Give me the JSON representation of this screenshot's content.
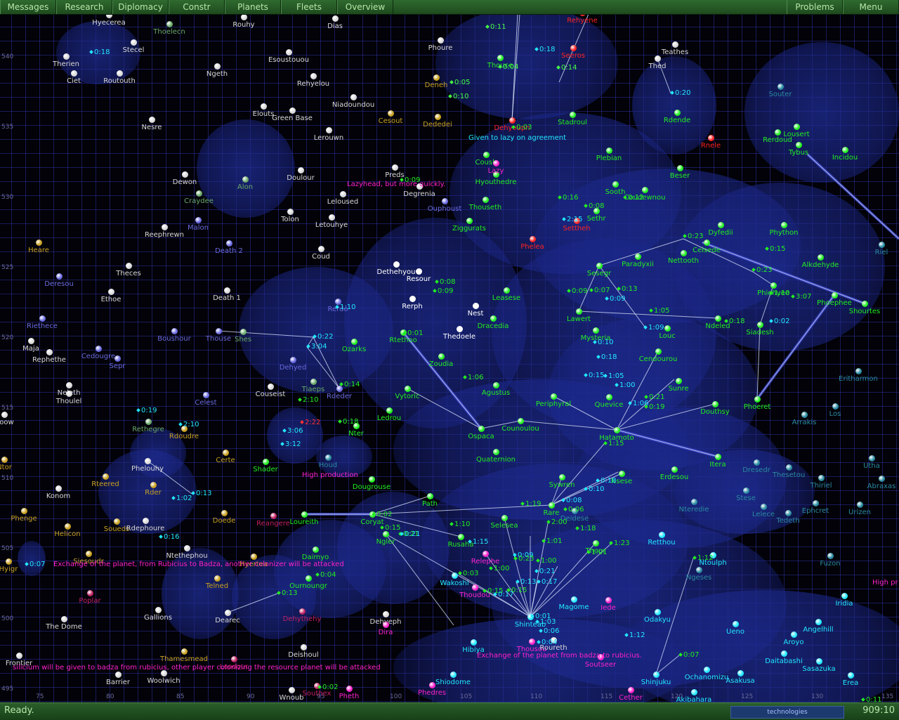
{
  "menu": {
    "items": [
      "Messages",
      "Research",
      "Diplomacy",
      "Constr",
      "Planets",
      "Fleets",
      "Overview"
    ],
    "right_items": [
      "Problems",
      "Menu"
    ]
  },
  "status": {
    "text": "Ready.",
    "clock": "909:10",
    "logo_text": "technologies"
  },
  "colors": {
    "player": "#22ee22",
    "neutral": "#d8d8d8",
    "bright": "#ffffff",
    "gold": "#c8a020",
    "enemy_red": "#ff2222",
    "magenta": "#ff22cc",
    "cyan": "#22e8ff",
    "dim_green": "#6aa86a",
    "violet": "#6a6ae0",
    "teal": "#2a8aa0",
    "maroon": "#c02060"
  },
  "x_axis": [
    "75",
    "80",
    "85",
    "90",
    "95",
    "100",
    "105",
    "110",
    "115",
    "120",
    "125",
    "130",
    "135"
  ],
  "y_axis": [
    "540",
    "535",
    "530",
    "525",
    "520",
    "515",
    "510",
    "505",
    "500",
    "495"
  ],
  "stars": [
    {
      "n": "Hyecerea",
      "c": "neutral"
    },
    {
      "n": "Thoelecn",
      "c": "dim_green"
    },
    {
      "n": "Rouhy",
      "c": "neutral"
    },
    {
      "n": "Dias",
      "c": "neutral"
    },
    {
      "n": "Therien",
      "c": "neutral"
    },
    {
      "n": "Stecel",
      "c": "neutral"
    },
    {
      "n": "Ciet",
      "c": "neutral"
    },
    {
      "n": "Routouth",
      "c": "neutral"
    },
    {
      "n": "Ngeth",
      "c": "neutral"
    },
    {
      "n": "Esoustouou",
      "c": "neutral"
    },
    {
      "n": "Rehyelou",
      "c": "neutral"
    },
    {
      "n": "Niadoundou",
      "c": "neutral"
    },
    {
      "n": "Nesre",
      "c": "neutral"
    },
    {
      "n": "Elouts",
      "c": "neutral"
    },
    {
      "n": "Green Base",
      "c": "neutral"
    },
    {
      "n": "Lerouwn",
      "c": "neutral"
    },
    {
      "n": "Cesout",
      "c": "gold"
    },
    {
      "n": "Phoure",
      "c": "neutral"
    },
    {
      "n": "Deneh",
      "c": "gold"
    },
    {
      "n": "Dededei",
      "c": "gold"
    },
    {
      "n": "Thouce",
      "c": "player"
    },
    {
      "n": "Seeros",
      "c": "enemy_red"
    },
    {
      "n": "Rehyene",
      "c": "enemy_red"
    },
    {
      "n": "Dehyouph",
      "c": "enemy_red"
    },
    {
      "n": "Stadroul",
      "c": "player"
    },
    {
      "n": "Teathes",
      "c": "neutral"
    },
    {
      "n": "Thed",
      "c": "neutral"
    },
    {
      "n": "Rdende",
      "c": "player"
    },
    {
      "n": "Souter",
      "c": "teal"
    },
    {
      "n": "Rnele",
      "c": "enemy_red"
    },
    {
      "n": "Rerdoud",
      "c": "player"
    },
    {
      "n": "Lousert",
      "c": "player"
    },
    {
      "n": "Tybus",
      "c": "player"
    },
    {
      "n": "Incidou",
      "c": "player"
    },
    {
      "n": "Dewon",
      "c": "neutral"
    },
    {
      "n": "Alon",
      "c": "dim_green"
    },
    {
      "n": "Doulour",
      "c": "neutral"
    },
    {
      "n": "Craydee",
      "c": "dim_green"
    },
    {
      "n": "Preds",
      "c": "neutral"
    },
    {
      "n": "Degrenia",
      "c": "neutral"
    },
    {
      "n": "Ouphoust",
      "c": "violet"
    },
    {
      "n": "Leloused",
      "c": "neutral"
    },
    {
      "n": "Coush",
      "c": "player"
    },
    {
      "n": "Hyouthedre",
      "c": "player"
    },
    {
      "n": "Plebian",
      "c": "player"
    },
    {
      "n": "Beser",
      "c": "player"
    },
    {
      "n": "Sooth",
      "c": "player"
    },
    {
      "n": "Coudewnou",
      "c": "player"
    },
    {
      "n": "Tolon",
      "c": "neutral"
    },
    {
      "n": "Malon",
      "c": "violet"
    },
    {
      "n": "Letouhye",
      "c": "neutral"
    },
    {
      "n": "Thouseth",
      "c": "player"
    },
    {
      "n": "Ziggurats",
      "c": "player"
    },
    {
      "n": "Sethr",
      "c": "player"
    },
    {
      "n": "Settheh",
      "c": "enemy_red"
    },
    {
      "n": "Dyfedii",
      "c": "player"
    },
    {
      "n": "Phython",
      "c": "player"
    },
    {
      "n": "Reephrewn",
      "c": "neutral"
    },
    {
      "n": "Heare",
      "c": "gold"
    },
    {
      "n": "Death 2",
      "c": "violet"
    },
    {
      "n": "Coud",
      "c": "neutral"
    },
    {
      "n": "Phelea",
      "c": "enemy_red"
    },
    {
      "n": "Ceisede",
      "c": "player"
    },
    {
      "n": "Nettooth",
      "c": "player"
    },
    {
      "n": "Paradyxii",
      "c": "player"
    },
    {
      "n": "Alkdehyde",
      "c": "player"
    },
    {
      "n": "Riel",
      "c": "teal"
    },
    {
      "n": "Theces",
      "c": "neutral"
    },
    {
      "n": "Deresou",
      "c": "violet"
    },
    {
      "n": "Dethehyou",
      "c": "bright"
    },
    {
      "n": "Resour",
      "c": "bright"
    },
    {
      "n": "Sesegr",
      "c": "player"
    },
    {
      "n": "Phiehyee",
      "c": "player"
    },
    {
      "n": "Ethoe",
      "c": "neutral"
    },
    {
      "n": "Death 1",
      "c": "neutral"
    },
    {
      "n": "Leasese",
      "c": "player"
    },
    {
      "n": "Rerph",
      "c": "bright"
    },
    {
      "n": "Nest",
      "c": "bright"
    },
    {
      "n": "Lawert",
      "c": "player"
    },
    {
      "n": "Ndeled",
      "c": "player"
    },
    {
      "n": "Siadesh",
      "c": "player"
    },
    {
      "n": "Phoephee",
      "c": "player"
    },
    {
      "n": "Shourtes",
      "c": "player"
    },
    {
      "n": "Riethece",
      "c": "violet"
    },
    {
      "n": "Boushour",
      "c": "violet"
    },
    {
      "n": "Thouse",
      "c": "violet"
    },
    {
      "n": "Shes",
      "c": "dim_green"
    },
    {
      "n": "Rerdo",
      "c": "violet"
    },
    {
      "n": "Dracedia",
      "c": "player"
    },
    {
      "n": "Thedoele",
      "c": "bright"
    },
    {
      "n": "Mysteria",
      "c": "player"
    },
    {
      "n": "Louc",
      "c": "player"
    },
    {
      "n": "Maja",
      "c": "neutral"
    },
    {
      "n": "Rephethe",
      "c": "neutral"
    },
    {
      "n": "Cedougre",
      "c": "violet"
    },
    {
      "n": "Sepr",
      "c": "violet"
    },
    {
      "n": "Ozarks",
      "c": "player"
    },
    {
      "n": "Rtethoo",
      "c": "player"
    },
    {
      "n": "Dehyed",
      "c": "violet"
    },
    {
      "n": "Zoudia",
      "c": "player"
    },
    {
      "n": "Cendourou",
      "c": "player"
    },
    {
      "n": "Eritharmon",
      "c": "teal"
    },
    {
      "n": "Neleth",
      "c": "neutral"
    },
    {
      "n": "Thoulel",
      "c": "neutral"
    },
    {
      "n": "Couseist",
      "c": "neutral"
    },
    {
      "n": "Tiaeps",
      "c": "dim_green"
    },
    {
      "n": "Rdeder",
      "c": "violet"
    },
    {
      "n": "Agustus",
      "c": "player"
    },
    {
      "n": "Sunre",
      "c": "player"
    },
    {
      "n": "Celest",
      "c": "violet"
    },
    {
      "n": "Vytoric",
      "c": "player"
    },
    {
      "n": "Periphyral",
      "c": "player"
    },
    {
      "n": "Quevice",
      "c": "player"
    },
    {
      "n": "Douthsy",
      "c": "player"
    },
    {
      "n": "Phoeret",
      "c": "player"
    },
    {
      "n": "Arrakis",
      "c": "teal"
    },
    {
      "n": "Los",
      "c": "teal"
    },
    {
      "n": "Rethegre",
      "c": "dim_green"
    },
    {
      "n": "Rdoudre",
      "c": "gold"
    },
    {
      "n": "Ledrou",
      "c": "player"
    },
    {
      "n": "Nter",
      "c": "player"
    },
    {
      "n": "Counoulou",
      "c": "player"
    },
    {
      "n": "Ospaca",
      "c": "player"
    },
    {
      "n": "Hatamoto",
      "c": "player"
    },
    {
      "n": "Certe",
      "c": "gold"
    },
    {
      "n": "Quaternion",
      "c": "player"
    },
    {
      "n": "Itera",
      "c": "player"
    },
    {
      "n": "Phelouhy",
      "c": "neutral"
    },
    {
      "n": "Shader",
      "c": "player"
    },
    {
      "n": "Houd",
      "c": "teal"
    },
    {
      "n": "Utha",
      "c": "teal"
    },
    {
      "n": "Rteered",
      "c": "gold"
    },
    {
      "n": "Rder",
      "c": "gold"
    },
    {
      "n": "Dougrouse",
      "c": "player"
    },
    {
      "n": "Dresedr",
      "c": "teal"
    },
    {
      "n": "Thesetou",
      "c": "teal"
    },
    {
      "n": "Thiriel",
      "c": "teal"
    },
    {
      "n": "Abraxas",
      "c": "teal"
    },
    {
      "n": "Konom",
      "c": "neutral"
    },
    {
      "n": "Sywren",
      "c": "player"
    },
    {
      "n": "Nsese",
      "c": "player"
    },
    {
      "n": "Erdesou",
      "c": "player"
    },
    {
      "n": "Phenge",
      "c": "gold"
    },
    {
      "n": "Doede",
      "c": "gold"
    },
    {
      "n": "Path",
      "c": "player"
    },
    {
      "n": "Loureith",
      "c": "player"
    },
    {
      "n": "Rare",
      "c": "player"
    },
    {
      "n": "Deidese",
      "c": "teal"
    },
    {
      "n": "Nteredie",
      "c": "teal"
    },
    {
      "n": "Stese",
      "c": "teal"
    },
    {
      "n": "Lelece",
      "c": "teal"
    },
    {
      "n": "Tedeth",
      "c": "teal"
    },
    {
      "n": "Ephcret",
      "c": "teal"
    },
    {
      "n": "Urizen",
      "c": "teal"
    },
    {
      "n": "Helicon",
      "c": "gold"
    },
    {
      "n": "Soueds",
      "c": "gold"
    },
    {
      "n": "Rdephoure",
      "c": "neutral"
    },
    {
      "n": "Reangere",
      "c": "maroon"
    },
    {
      "n": "Coryat",
      "c": "player"
    },
    {
      "n": "Selesea",
      "c": "player"
    },
    {
      "n": "Ngler",
      "c": "player"
    },
    {
      "n": "Rusaha",
      "c": "player"
    },
    {
      "n": "Ntethephou",
      "c": "neutral"
    },
    {
      "n": "Siesoudr",
      "c": "gold"
    },
    {
      "n": "Daimyo",
      "c": "player"
    },
    {
      "n": "Hyertea",
      "c": "gold"
    },
    {
      "n": "Thour",
      "c": "player"
    },
    {
      "n": "Retthou",
      "c": "cyan"
    },
    {
      "n": "Ntoulph",
      "c": "cyan"
    },
    {
      "n": "Fuzon",
      "c": "teal"
    },
    {
      "n": "Relephe",
      "c": "magenta"
    },
    {
      "n": "Ngeses",
      "c": "teal"
    },
    {
      "n": "Telned",
      "c": "gold"
    },
    {
      "n": "Ournoungr",
      "c": "player"
    },
    {
      "n": "Wakoshi",
      "c": "cyan"
    },
    {
      "n": "Thoudou",
      "c": "magenta"
    },
    {
      "n": "Poplar",
      "c": "maroon"
    },
    {
      "n": "Magome",
      "c": "cyan"
    },
    {
      "n": "Iede",
      "c": "magenta"
    },
    {
      "n": "Iridia",
      "c": "cyan"
    },
    {
      "n": "Gallions",
      "c": "neutral"
    },
    {
      "n": "Dearec",
      "c": "neutral"
    },
    {
      "n": "Dehythehy",
      "c": "maroon"
    },
    {
      "n": "Dehyeph",
      "c": "neutral"
    },
    {
      "n": "Shinteab",
      "c": "cyan"
    },
    {
      "n": "Odakyu",
      "c": "cyan"
    },
    {
      "n": "The Dome",
      "c": "neutral"
    },
    {
      "n": "Dira",
      "c": "magenta"
    },
    {
      "n": "Ueno",
      "c": "cyan"
    },
    {
      "n": "Angelhill",
      "c": "cyan"
    },
    {
      "n": "Aroyo",
      "c": "cyan"
    },
    {
      "n": "Hibiya",
      "c": "cyan"
    },
    {
      "n": "Thousou",
      "c": "magenta"
    },
    {
      "n": "Roureth",
      "c": "neutral"
    },
    {
      "n": "Thamesmead",
      "c": "gold"
    },
    {
      "n": "Deishoul",
      "c": "neutral"
    },
    {
      "n": "Soutseer",
      "c": "magenta"
    },
    {
      "n": "Daitabashi",
      "c": "cyan"
    },
    {
      "n": "Sasazuka",
      "c": "cyan"
    },
    {
      "n": "Frontier",
      "c": "neutral"
    },
    {
      "n": "Leodour",
      "c": "maroon"
    },
    {
      "n": "Shinjuku",
      "c": "cyan"
    },
    {
      "n": "Ochanomizu",
      "c": "cyan"
    },
    {
      "n": "Asakusa",
      "c": "cyan"
    },
    {
      "n": "Erea",
      "c": "cyan"
    },
    {
      "n": "Barrier",
      "c": "neutral"
    },
    {
      "n": "Woolwich",
      "c": "neutral"
    },
    {
      "n": "Shiodome",
      "c": "cyan"
    },
    {
      "n": "Phedres",
      "c": "magenta"
    },
    {
      "n": "Wnoub",
      "c": "neutral"
    },
    {
      "n": "Southex",
      "c": "maroon"
    },
    {
      "n": "Pheth",
      "c": "magenta"
    },
    {
      "n": "Akibahara",
      "c": "cyan"
    },
    {
      "n": "Cether",
      "c": "magenta"
    },
    {
      "n": "Boow",
      "c": "neutral"
    },
    {
      "n": "Ntor",
      "c": "gold"
    },
    {
      "n": "Hyigr",
      "c": "gold"
    },
    {
      "n": "Lazy",
      "c": "magenta"
    }
  ],
  "etas": [
    "0:18",
    "0:11",
    "0:04",
    "0:18",
    "0:14",
    "0:05",
    "0:10",
    "0:03",
    "0:20",
    "0:09",
    "0:16",
    "0:08",
    "0:12",
    "2:15",
    "0:23",
    "0:15",
    "0:23",
    "0:08",
    "0:09",
    "1:10",
    "0:09",
    "0:07",
    "0:13",
    "0:09",
    "1:05",
    "1:10",
    "3:07",
    "0:18",
    "0:02",
    "0:22",
    "3:04",
    "1:09",
    "0:10",
    "0:18",
    "0:15",
    "1:05",
    "1:00",
    "1:06",
    "0:21",
    "0:19",
    "0:01",
    "0:14",
    "1:06",
    "2:10",
    "0:18",
    "2:22",
    "0:19",
    "2:10",
    "3:06",
    "3:12",
    "0:13",
    "1:02",
    "1:15",
    "0:18",
    "0:10",
    "0:08",
    "0:06",
    "1:19",
    "0:02",
    "0:15",
    "0:21",
    "1:10",
    "1:15",
    "2:00",
    "1:01",
    "1:18",
    "1:23",
    "1:01",
    "0:09",
    "0:23",
    "1:00",
    "0:21",
    "0:17",
    "0:13",
    "0:03",
    "0:15",
    "1:00",
    "0:17",
    "0:15",
    "0:21",
    "0:16",
    "0:07",
    "0:04",
    "0:13",
    "1:12",
    "0:01",
    "1:03",
    "0:06",
    "0:04",
    "1:12",
    "0:07",
    "0:02",
    "0:11"
  ],
  "messages": [
    {
      "t": "Given to lazy on agreement",
      "c": "cyan"
    },
    {
      "t": "Lazyhead, but more quickly.",
      "c": "magenta"
    },
    {
      "t": "High production",
      "c": "magenta"
    },
    {
      "t": "Exchange of the planet, from Rubicius to Badza, another colonizer will be attacked",
      "c": "magenta"
    },
    {
      "t": "Exchange of the planet from badza to rubicius.",
      "c": "magenta"
    },
    {
      "t": "silicium will be given to badza from rubicius, other player colonizing the resource planet will be attacked",
      "c": "magenta"
    },
    {
      "t": "High pr",
      "c": "magenta"
    }
  ]
}
